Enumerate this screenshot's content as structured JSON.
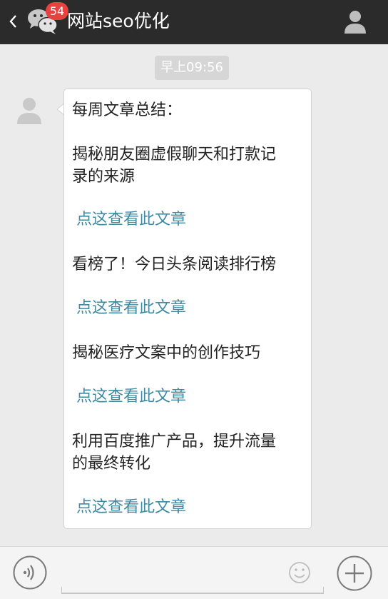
{
  "header": {
    "title": "网站seo优化",
    "unread_badge": "54",
    "back_icon": "chevron-left-icon",
    "app_icon": "wechat-icon",
    "profile_icon": "person-icon"
  },
  "timestamp": "早上09:56",
  "message": {
    "avatar_icon": "default-avatar-icon",
    "heading": "每周文章总结：",
    "articles": [
      {
        "title_lines": [
          "揭秘朋友圈虚假聊天和打款记",
          "录的来源"
        ],
        "link": "点这查看此文章"
      },
      {
        "title_lines": [
          "看榜了！今日头条阅读排行榜"
        ],
        "link": "点这查看此文章"
      },
      {
        "title_lines": [
          "揭秘医疗文案中的创作技巧"
        ],
        "link": "点这查看此文章"
      },
      {
        "title_lines": [
          "利用百度推广产品，提升流量",
          "的最终转化"
        ],
        "link": "点这查看此文章"
      }
    ]
  },
  "footer": {
    "voice_icon": "voice-icon",
    "emoji_icon": "emoji-icon",
    "plus_icon": "plus-icon"
  },
  "colors": {
    "header_bg": "#2b2b2b",
    "chat_bg": "#ebebeb",
    "badge": "#e64340",
    "link": "#3d8aa3"
  }
}
